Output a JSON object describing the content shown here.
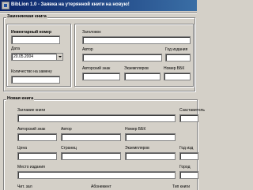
{
  "window": {
    "title": "BibLion 1.0 - Заявка на утерянной книги на новую!"
  },
  "replaced": {
    "group_title": "Заменяемая книга",
    "inventory_label": "Инвентарный номер",
    "inventory_value": "",
    "date_label": "Дата",
    "date_value": "20.05.2004",
    "qty_label": "Количество на замену",
    "qty_value": "",
    "title_label": "Заголовок",
    "title_value": "",
    "author_label": "Автор",
    "year_label": "Год издания",
    "author_sign_label": "Авторский знак",
    "copies_label": "Экземпляров",
    "bbk_label": "Номер ББК"
  },
  "new_book": {
    "group_title": "Новая книга",
    "title_label": "Заглавие книги",
    "compiler_label": "Сзаставитель",
    "author_sign_label": "Авторский знак",
    "author_label": "Автор",
    "bbk_label": "Номер ББК",
    "price_label": "Цена",
    "pages_label": "Страниц",
    "copies_label": "Экземпляров",
    "year_label": "Год изд",
    "place_label": "Место издания",
    "city_label": "Город",
    "reader_label": "Чит. зал",
    "subscription_label": "Абонемент",
    "type_label": "Тип книги"
  }
}
